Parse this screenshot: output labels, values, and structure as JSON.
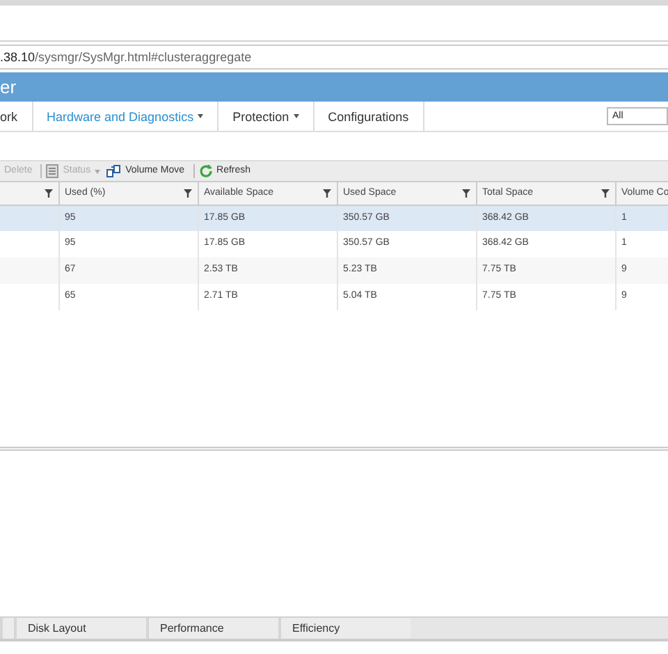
{
  "address_bar": {
    "host": ".38.10",
    "path": "/sysmgr/SysMgr.html#clusteraggregate"
  },
  "app_title": "er",
  "nav": [
    {
      "label": "ork",
      "selected": false,
      "dropdown": false
    },
    {
      "label": "Hardware and Diagnostics",
      "selected": true,
      "dropdown": true
    },
    {
      "label": "Protection",
      "selected": false,
      "dropdown": true
    },
    {
      "label": "Configurations",
      "selected": false,
      "dropdown": false
    }
  ],
  "scope_select": {
    "value": "All"
  },
  "toolbar": [
    {
      "kind": "text",
      "label": "Delete",
      "disabled": true
    },
    {
      "kind": "sep"
    },
    {
      "kind": "status",
      "label": "Status",
      "disabled": true
    },
    {
      "kind": "move",
      "label": "Volume Move",
      "disabled": false
    },
    {
      "kind": "sep"
    },
    {
      "kind": "refresh",
      "label": "Refresh",
      "disabled": false
    }
  ],
  "table": {
    "columns": [
      "",
      "Used (%)",
      "Available Space",
      "Used Space",
      "Total Space",
      "Volume Co"
    ],
    "rows": [
      {
        "selected": true,
        "cells": [
          "",
          "95",
          "17.85 GB",
          "350.57 GB",
          "368.42 GB",
          "1"
        ]
      },
      {
        "selected": false,
        "cells": [
          "",
          "95",
          "17.85 GB",
          "350.57 GB",
          "368.42 GB",
          "1"
        ]
      },
      {
        "selected": false,
        "cells": [
          "",
          "67",
          "2.53 TB",
          "5.23 TB",
          "7.75 TB",
          "9"
        ]
      },
      {
        "selected": false,
        "cells": [
          "",
          "65",
          "2.71 TB",
          "5.04 TB",
          "7.75 TB",
          "9"
        ]
      }
    ]
  },
  "detail_tabs": [
    {
      "label": "Disk Layout",
      "selected": false
    },
    {
      "label": "Performance",
      "selected": false
    },
    {
      "label": "Efficiency",
      "selected": false
    }
  ]
}
